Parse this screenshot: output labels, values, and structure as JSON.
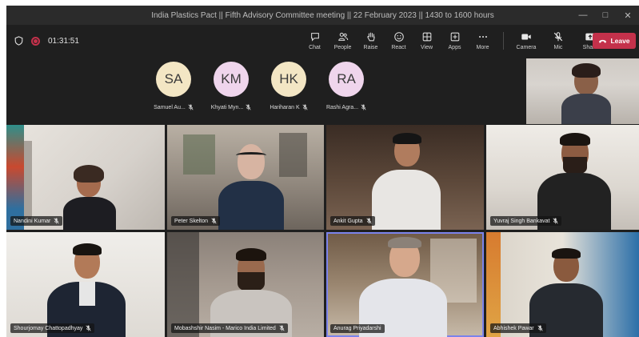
{
  "window": {
    "title": "India Plastics Pact || Fifth Advisory Committee meeting || 22 February 2023 || 1430 to 1600 hours"
  },
  "status": {
    "timer": "01:31:51"
  },
  "toolbar": {
    "chat": "Chat",
    "people": "People",
    "raise": "Raise",
    "react": "React",
    "view": "View",
    "apps": "Apps",
    "more": "More",
    "camera": "Camera",
    "mic": "Mic",
    "share": "Share",
    "leave": "Leave"
  },
  "avatars": [
    {
      "initials": "SA",
      "name": "Samuel Au...",
      "color": "#f3e6c4"
    },
    {
      "initials": "KM",
      "name": "Khyati Myn...",
      "color": "#efd5ec"
    },
    {
      "initials": "HK",
      "name": "Hariharan K",
      "color": "#f3e6c4"
    },
    {
      "initials": "RA",
      "name": "Rashi Agra...",
      "color": "#efd5ec"
    }
  ],
  "participants": [
    {
      "name": "Nandini Kumar"
    },
    {
      "name": "Peter Skelton"
    },
    {
      "name": "Ankit Gupta"
    },
    {
      "name": "Yuvraj Singh Bankavat"
    },
    {
      "name": "Shourjomay Chattopadhyay"
    },
    {
      "name": "Mobashshir Nasim - Marico India Limited"
    },
    {
      "name": "Anurag Priyadarshi"
    },
    {
      "name": "Abhishek Pawar"
    }
  ],
  "colors": {
    "leave": "#c4314b",
    "active_speaker": "#7b83eb"
  }
}
